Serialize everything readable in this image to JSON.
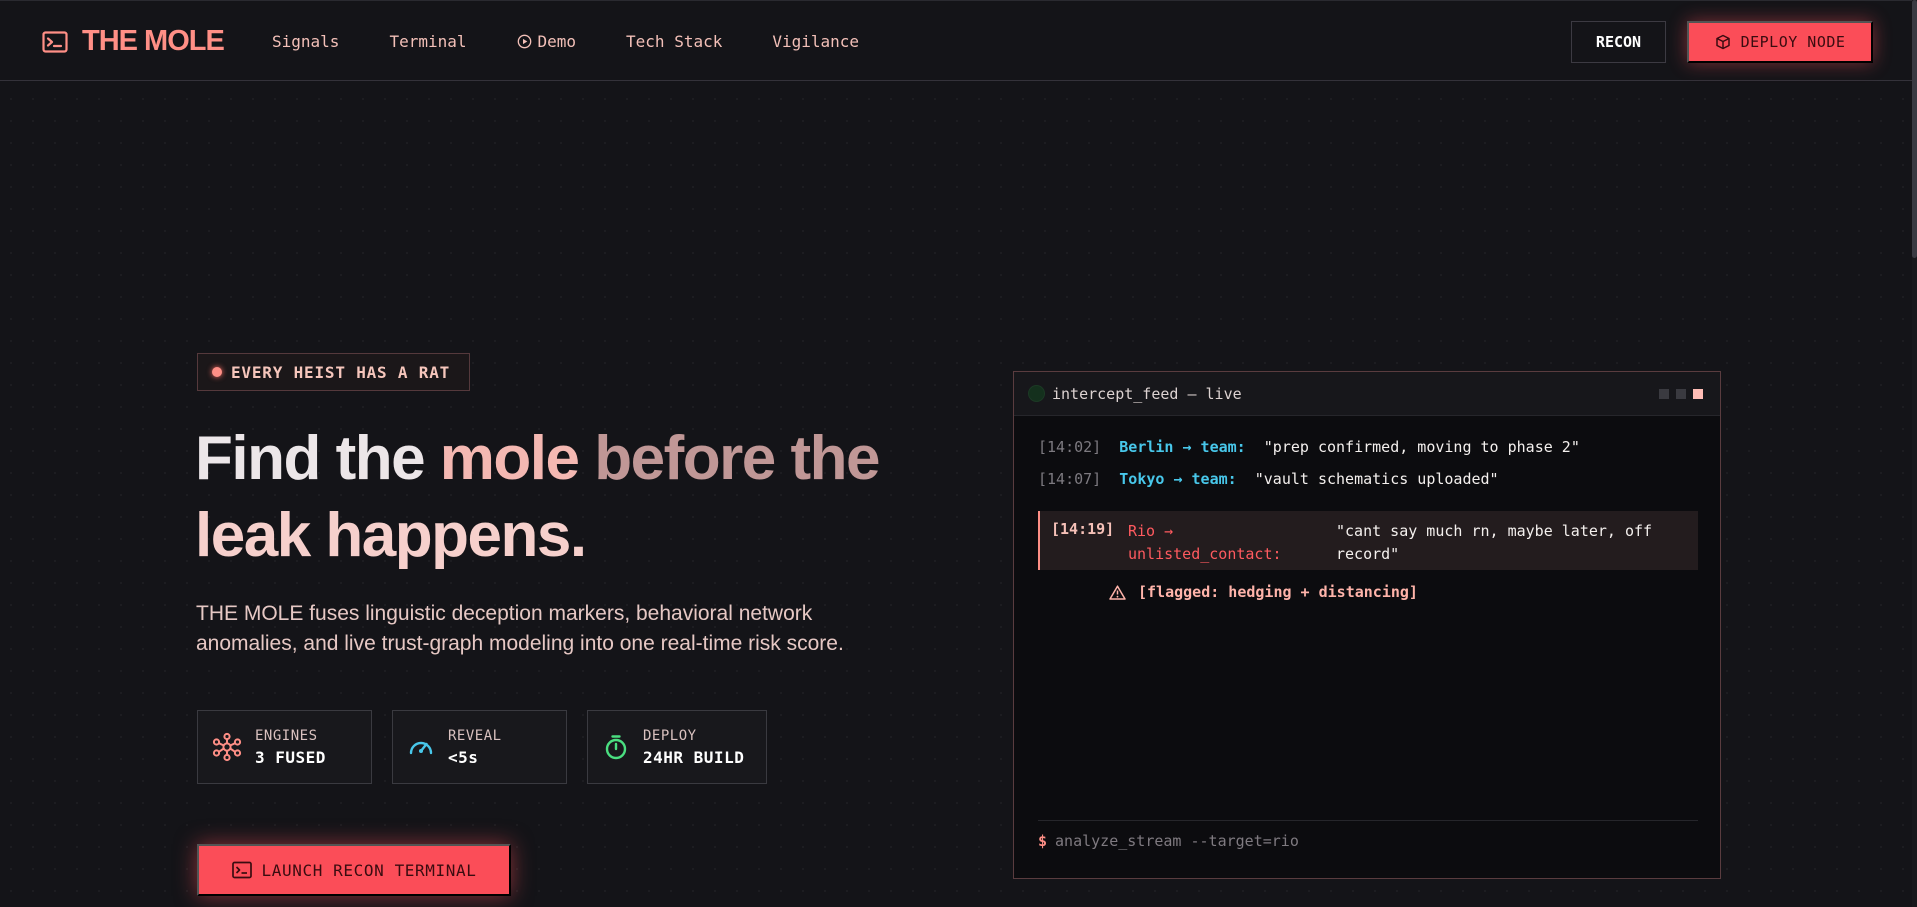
{
  "brand": {
    "name": "THE MOLE"
  },
  "nav": {
    "links": [
      {
        "label": "Signals"
      },
      {
        "label": "Terminal"
      },
      {
        "label": "Demo"
      },
      {
        "label": "Tech Stack"
      },
      {
        "label": "Vigilance"
      }
    ],
    "recon_label": "RECON",
    "deploy_label": "DEPLOY NODE"
  },
  "hero": {
    "badge": "EVERY HEIST HAS A RAT",
    "headline": {
      "part1": "Find the ",
      "part2": "mole ",
      "part3": "before the",
      "part4": "leak happens."
    },
    "subhead": "THE MOLE fuses linguistic deception markers, behavioral network anomalies, and live trust-graph modeling into one real-time risk score.",
    "stats": [
      {
        "label": "ENGINES",
        "value": "3 FUSED",
        "icon": "network-icon",
        "color": "#ff8f86"
      },
      {
        "label": "REVEAL",
        "value": "<5s",
        "icon": "speedometer-icon",
        "color": "#48c7ea"
      },
      {
        "label": "DEPLOY",
        "value": "24HR BUILD",
        "icon": "stopwatch-icon",
        "color": "#4ade80"
      }
    ],
    "cta": "LAUNCH RECON TERMINAL"
  },
  "terminal": {
    "title": "intercept_feed — live",
    "lines": [
      {
        "time": "[14:02]",
        "who": "Berlin → team:",
        "msg": "\"prep confirmed, moving to phase 2\""
      },
      {
        "time": "[14:07]",
        "who": "Tokyo → team:",
        "msg": "\"vault schematics uploaded\""
      }
    ],
    "flagged": {
      "time": "[14:19]",
      "who": "Rio → unlisted_contact:",
      "msg": "\"cant say much rn, maybe later, off record\"",
      "note": "[flagged: hedging + distancing]"
    },
    "prompt_symbol": "$",
    "prompt_command": "analyze_stream --target=rio"
  },
  "colors": {
    "accent": "#fb4d58",
    "accent_soft": "#ff8f86",
    "cyan": "#48c7ea",
    "green": "#4ade80",
    "background": "#141418"
  }
}
